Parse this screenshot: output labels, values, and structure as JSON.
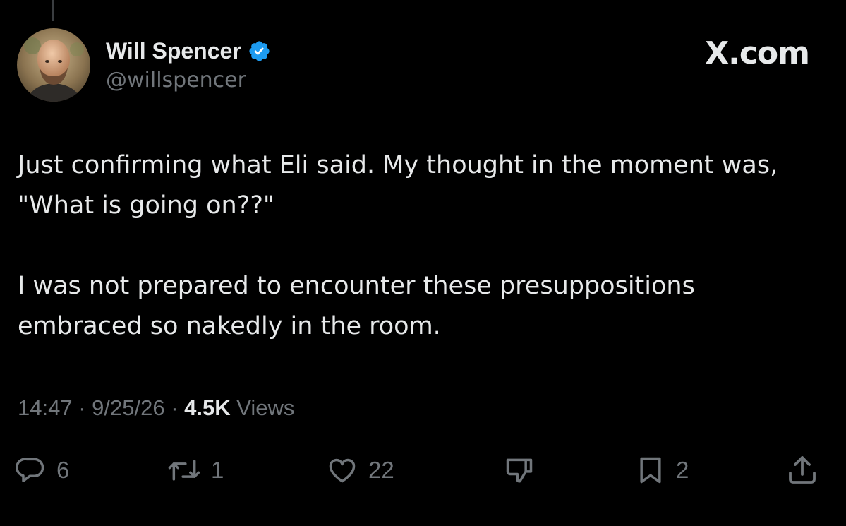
{
  "post": {
    "author": {
      "display_name": "Will Spencer",
      "handle": "@willspencer",
      "verified_icon": "verified-badge-icon",
      "avatar": "bald bearded man photo"
    },
    "brand": "X.com",
    "body": {
      "paragraph_1_line_1": "Just confirming what Eli said. My thought in the moment was,",
      "paragraph_1_line_2": "\"What is going on??\"",
      "paragraph_2_line_1": "I was not prepared to encounter these presuppositions",
      "paragraph_2_line_2": "embraced so nakedly in the room."
    },
    "meta": {
      "time": "14:47",
      "separator": " · ",
      "date": "9/25/26",
      "views_count": "4.5K",
      "views_label": " Views"
    },
    "actions": {
      "reply": {
        "icon": "reply-icon",
        "count": "6"
      },
      "retweet": {
        "icon": "retweet-icon",
        "count": "1"
      },
      "like": {
        "icon": "heart-icon",
        "count": "22"
      },
      "dislike": {
        "icon": "dislike-icon"
      },
      "bookmark": {
        "icon": "bookmark-icon",
        "count": "2"
      },
      "share": {
        "icon": "share-icon"
      }
    },
    "colors": {
      "background": "#000000",
      "text_primary": "#e7e9ea",
      "text_secondary": "#71767b",
      "verified_blue": "#1d9bf0"
    }
  }
}
